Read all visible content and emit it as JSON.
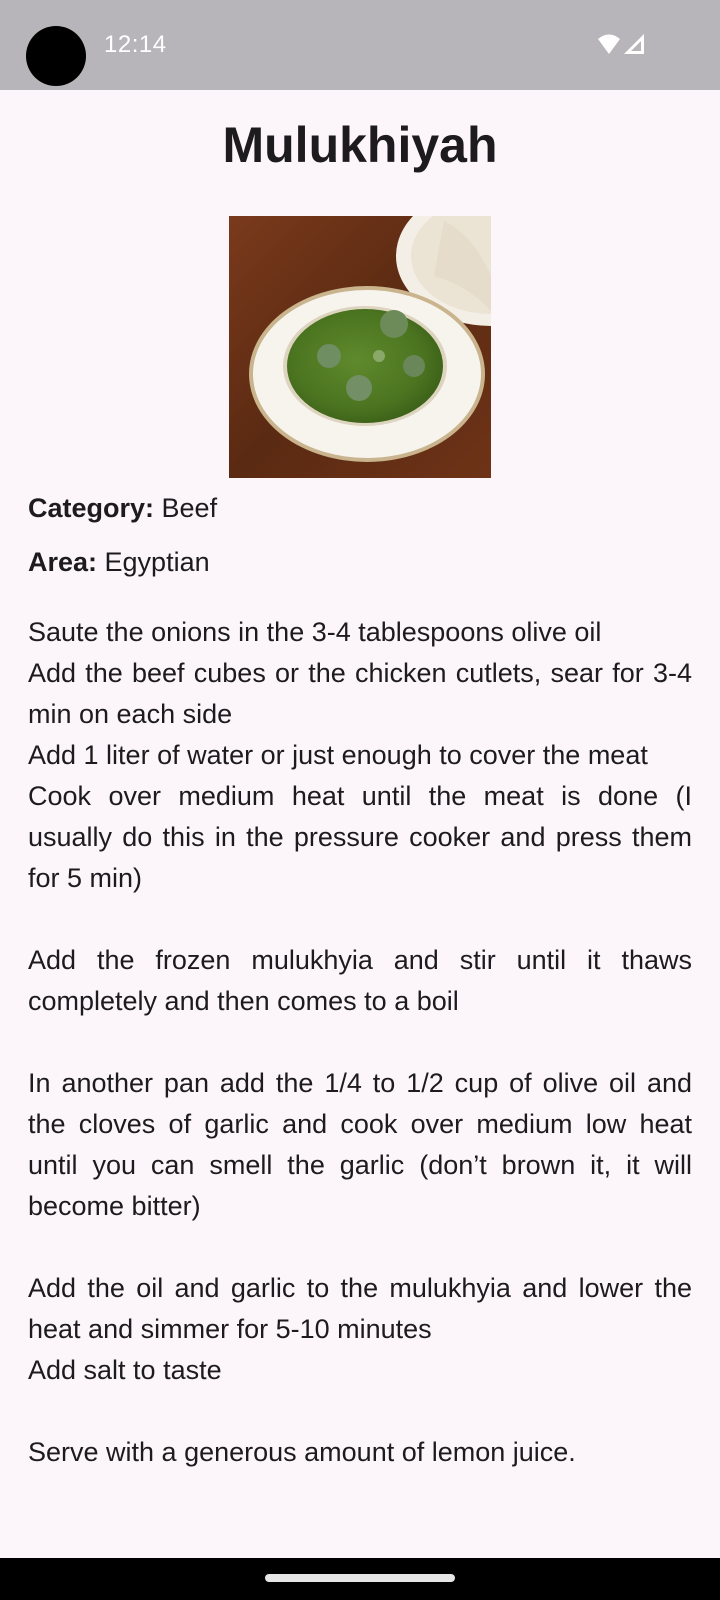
{
  "status_bar": {
    "time": "12:14",
    "icons": [
      "wifi-icon",
      "signal-icon"
    ]
  },
  "meal": {
    "title": "Mulukhiyah",
    "image_alt": "Bowl of green mulukhiyah stew with meat",
    "category_key": "Category:",
    "category_value": " Beef",
    "area_key": "Area:",
    "area_value": " Egyptian",
    "instructions": {
      "line1": "Saute the onions in the 3-4 tablespoons olive oil",
      "line2": "Add the beef cubes or the chicken cutlets, sear for 3-4 min on each side",
      "line3": "Add 1 liter of water or just enough to cover the meat",
      "line4": "Cook over medium heat until the meat is done (I usually do this in the pressure cooker and press them for 5 min)",
      "line5": "Add the frozen mulukhyia and stir until it thaws completely and then comes to a boil",
      "line6": "In another pan add the 1/4 to 1/2 cup of olive oil and the cloves of garlic and cook over medium low heat until you can smell the garlic (don’t brown it, it will become bitter)",
      "line7": "Add the oil and garlic to the mulukhyia and lower the heat and simmer for 5-10 minutes",
      "line8": "Add salt to taste",
      "line9": "Serve with a generous amount of lemon juice."
    }
  },
  "colors": {
    "background": "#fcf6fb",
    "status_bar": "#b8b5ba",
    "text": "#1d1b1e",
    "nav_bar": "#000000"
  }
}
